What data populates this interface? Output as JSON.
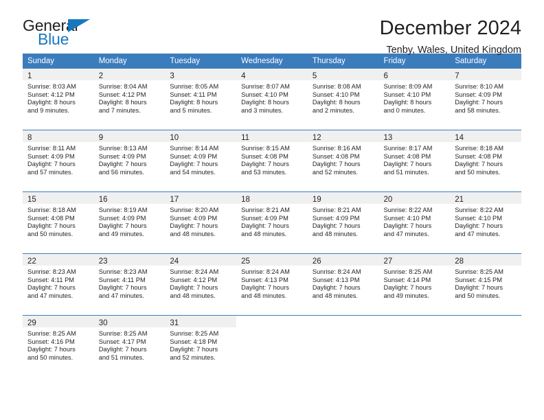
{
  "brand": {
    "name_part1": "General",
    "name_part2": "Blue",
    "accent_color": "#1878be",
    "triangle_icon": "triangle-icon"
  },
  "header": {
    "title": "December 2024",
    "subtitle": "Tenby, Wales, United Kingdom"
  },
  "theme": {
    "header_row_color": "#3b7cbd",
    "daynum_band_color": "#f0f0f0",
    "text_color": "#231f20"
  },
  "weekday_headers": [
    "Sunday",
    "Monday",
    "Tuesday",
    "Wednesday",
    "Thursday",
    "Friday",
    "Saturday"
  ],
  "weeks": [
    [
      {
        "day": "1",
        "sunrise": "Sunrise: 8:03 AM",
        "sunset": "Sunset: 4:12 PM",
        "daylight_line1": "Daylight: 8 hours",
        "daylight_line2": "and 9 minutes."
      },
      {
        "day": "2",
        "sunrise": "Sunrise: 8:04 AM",
        "sunset": "Sunset: 4:12 PM",
        "daylight_line1": "Daylight: 8 hours",
        "daylight_line2": "and 7 minutes."
      },
      {
        "day": "3",
        "sunrise": "Sunrise: 8:05 AM",
        "sunset": "Sunset: 4:11 PM",
        "daylight_line1": "Daylight: 8 hours",
        "daylight_line2": "and 5 minutes."
      },
      {
        "day": "4",
        "sunrise": "Sunrise: 8:07 AM",
        "sunset": "Sunset: 4:10 PM",
        "daylight_line1": "Daylight: 8 hours",
        "daylight_line2": "and 3 minutes."
      },
      {
        "day": "5",
        "sunrise": "Sunrise: 8:08 AM",
        "sunset": "Sunset: 4:10 PM",
        "daylight_line1": "Daylight: 8 hours",
        "daylight_line2": "and 2 minutes."
      },
      {
        "day": "6",
        "sunrise": "Sunrise: 8:09 AM",
        "sunset": "Sunset: 4:10 PM",
        "daylight_line1": "Daylight: 8 hours",
        "daylight_line2": "and 0 minutes."
      },
      {
        "day": "7",
        "sunrise": "Sunrise: 8:10 AM",
        "sunset": "Sunset: 4:09 PM",
        "daylight_line1": "Daylight: 7 hours",
        "daylight_line2": "and 58 minutes."
      }
    ],
    [
      {
        "day": "8",
        "sunrise": "Sunrise: 8:11 AM",
        "sunset": "Sunset: 4:09 PM",
        "daylight_line1": "Daylight: 7 hours",
        "daylight_line2": "and 57 minutes."
      },
      {
        "day": "9",
        "sunrise": "Sunrise: 8:13 AM",
        "sunset": "Sunset: 4:09 PM",
        "daylight_line1": "Daylight: 7 hours",
        "daylight_line2": "and 56 minutes."
      },
      {
        "day": "10",
        "sunrise": "Sunrise: 8:14 AM",
        "sunset": "Sunset: 4:09 PM",
        "daylight_line1": "Daylight: 7 hours",
        "daylight_line2": "and 54 minutes."
      },
      {
        "day": "11",
        "sunrise": "Sunrise: 8:15 AM",
        "sunset": "Sunset: 4:08 PM",
        "daylight_line1": "Daylight: 7 hours",
        "daylight_line2": "and 53 minutes."
      },
      {
        "day": "12",
        "sunrise": "Sunrise: 8:16 AM",
        "sunset": "Sunset: 4:08 PM",
        "daylight_line1": "Daylight: 7 hours",
        "daylight_line2": "and 52 minutes."
      },
      {
        "day": "13",
        "sunrise": "Sunrise: 8:17 AM",
        "sunset": "Sunset: 4:08 PM",
        "daylight_line1": "Daylight: 7 hours",
        "daylight_line2": "and 51 minutes."
      },
      {
        "day": "14",
        "sunrise": "Sunrise: 8:18 AM",
        "sunset": "Sunset: 4:08 PM",
        "daylight_line1": "Daylight: 7 hours",
        "daylight_line2": "and 50 minutes."
      }
    ],
    [
      {
        "day": "15",
        "sunrise": "Sunrise: 8:18 AM",
        "sunset": "Sunset: 4:08 PM",
        "daylight_line1": "Daylight: 7 hours",
        "daylight_line2": "and 50 minutes."
      },
      {
        "day": "16",
        "sunrise": "Sunrise: 8:19 AM",
        "sunset": "Sunset: 4:09 PM",
        "daylight_line1": "Daylight: 7 hours",
        "daylight_line2": "and 49 minutes."
      },
      {
        "day": "17",
        "sunrise": "Sunrise: 8:20 AM",
        "sunset": "Sunset: 4:09 PM",
        "daylight_line1": "Daylight: 7 hours",
        "daylight_line2": "and 48 minutes."
      },
      {
        "day": "18",
        "sunrise": "Sunrise: 8:21 AM",
        "sunset": "Sunset: 4:09 PM",
        "daylight_line1": "Daylight: 7 hours",
        "daylight_line2": "and 48 minutes."
      },
      {
        "day": "19",
        "sunrise": "Sunrise: 8:21 AM",
        "sunset": "Sunset: 4:09 PM",
        "daylight_line1": "Daylight: 7 hours",
        "daylight_line2": "and 48 minutes."
      },
      {
        "day": "20",
        "sunrise": "Sunrise: 8:22 AM",
        "sunset": "Sunset: 4:10 PM",
        "daylight_line1": "Daylight: 7 hours",
        "daylight_line2": "and 47 minutes."
      },
      {
        "day": "21",
        "sunrise": "Sunrise: 8:22 AM",
        "sunset": "Sunset: 4:10 PM",
        "daylight_line1": "Daylight: 7 hours",
        "daylight_line2": "and 47 minutes."
      }
    ],
    [
      {
        "day": "22",
        "sunrise": "Sunrise: 8:23 AM",
        "sunset": "Sunset: 4:11 PM",
        "daylight_line1": "Daylight: 7 hours",
        "daylight_line2": "and 47 minutes."
      },
      {
        "day": "23",
        "sunrise": "Sunrise: 8:23 AM",
        "sunset": "Sunset: 4:11 PM",
        "daylight_line1": "Daylight: 7 hours",
        "daylight_line2": "and 47 minutes."
      },
      {
        "day": "24",
        "sunrise": "Sunrise: 8:24 AM",
        "sunset": "Sunset: 4:12 PM",
        "daylight_line1": "Daylight: 7 hours",
        "daylight_line2": "and 48 minutes."
      },
      {
        "day": "25",
        "sunrise": "Sunrise: 8:24 AM",
        "sunset": "Sunset: 4:13 PM",
        "daylight_line1": "Daylight: 7 hours",
        "daylight_line2": "and 48 minutes."
      },
      {
        "day": "26",
        "sunrise": "Sunrise: 8:24 AM",
        "sunset": "Sunset: 4:13 PM",
        "daylight_line1": "Daylight: 7 hours",
        "daylight_line2": "and 48 minutes."
      },
      {
        "day": "27",
        "sunrise": "Sunrise: 8:25 AM",
        "sunset": "Sunset: 4:14 PM",
        "daylight_line1": "Daylight: 7 hours",
        "daylight_line2": "and 49 minutes."
      },
      {
        "day": "28",
        "sunrise": "Sunrise: 8:25 AM",
        "sunset": "Sunset: 4:15 PM",
        "daylight_line1": "Daylight: 7 hours",
        "daylight_line2": "and 50 minutes."
      }
    ],
    [
      {
        "day": "29",
        "sunrise": "Sunrise: 8:25 AM",
        "sunset": "Sunset: 4:16 PM",
        "daylight_line1": "Daylight: 7 hours",
        "daylight_line2": "and 50 minutes."
      },
      {
        "day": "30",
        "sunrise": "Sunrise: 8:25 AM",
        "sunset": "Sunset: 4:17 PM",
        "daylight_line1": "Daylight: 7 hours",
        "daylight_line2": "and 51 minutes."
      },
      {
        "day": "31",
        "sunrise": "Sunrise: 8:25 AM",
        "sunset": "Sunset: 4:18 PM",
        "daylight_line1": "Daylight: 7 hours",
        "daylight_line2": "and 52 minutes."
      },
      {
        "day": "",
        "sunrise": "",
        "sunset": "",
        "daylight_line1": "",
        "daylight_line2": ""
      },
      {
        "day": "",
        "sunrise": "",
        "sunset": "",
        "daylight_line1": "",
        "daylight_line2": ""
      },
      {
        "day": "",
        "sunrise": "",
        "sunset": "",
        "daylight_line1": "",
        "daylight_line2": ""
      },
      {
        "day": "",
        "sunrise": "",
        "sunset": "",
        "daylight_line1": "",
        "daylight_line2": ""
      }
    ]
  ]
}
